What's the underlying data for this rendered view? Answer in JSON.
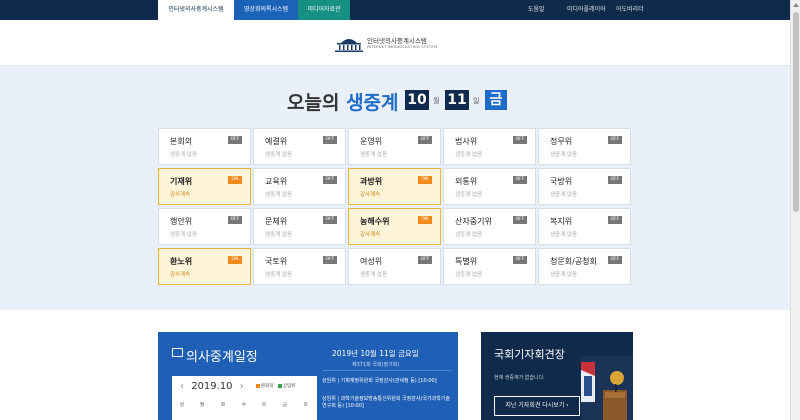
{
  "topbar": {
    "tabs": [
      {
        "label": "인터넷의사중계시스템"
      },
      {
        "label": "영상회의록시스템"
      },
      {
        "label": "미디어자료관"
      }
    ],
    "links": [
      {
        "label": "도움말"
      },
      {
        "label": "미디어플레이어"
      },
      {
        "label": "어도비리더"
      }
    ]
  },
  "logo": {
    "name_kr": "인터넷의사중계시스템",
    "name_en": "INTERNET BROADCASTING SYSTEM"
  },
  "today": {
    "prefix": "오늘의",
    "highlight": "생중계",
    "month": "10",
    "month_unit": "월",
    "day": "11",
    "day_unit": "일",
    "weekday": "금"
  },
  "committees": [
    {
      "name": "본회의",
      "status": "생중계 없음",
      "badge": "OFF",
      "live": false
    },
    {
      "name": "예결위",
      "status": "생중계 없음",
      "badge": "OFF",
      "live": false
    },
    {
      "name": "운영위",
      "status": "생중계 없음",
      "badge": "OFF",
      "live": false
    },
    {
      "name": "법사위",
      "status": "생중계 없음",
      "badge": "OFF",
      "live": false
    },
    {
      "name": "정무위",
      "status": "생중계 없음",
      "badge": "OFF",
      "live": false
    },
    {
      "name": "기재위",
      "status": "감사계속",
      "badge": "ON",
      "live": true
    },
    {
      "name": "교육위",
      "status": "생중계 없음",
      "badge": "OFF",
      "live": false
    },
    {
      "name": "과방위",
      "status": "감사계속",
      "badge": "ON",
      "live": true
    },
    {
      "name": "외통위",
      "status": "생중계 없음",
      "badge": "OFF",
      "live": false
    },
    {
      "name": "국방위",
      "status": "생중계 없음",
      "badge": "OFF",
      "live": false
    },
    {
      "name": "행안위",
      "status": "생중계 없음",
      "badge": "OFF",
      "live": false
    },
    {
      "name": "문체위",
      "status": "생중계 없음",
      "badge": "OFF",
      "live": false
    },
    {
      "name": "농해수위",
      "status": "감사계속",
      "badge": "ON",
      "live": true
    },
    {
      "name": "산자중기위",
      "status": "생중계 없음",
      "badge": "OFF",
      "live": false
    },
    {
      "name": "복지위",
      "status": "생중계 없음",
      "badge": "OFF",
      "live": false
    },
    {
      "name": "환노위",
      "status": "감사계속",
      "badge": "ON",
      "live": true
    },
    {
      "name": "국토위",
      "status": "생중계 없음",
      "badge": "OFF",
      "live": false
    },
    {
      "name": "여성위",
      "status": "생중계 없음",
      "badge": "OFF",
      "live": false
    },
    {
      "name": "특별위",
      "status": "생중계 없음",
      "badge": "OFF",
      "live": false
    },
    {
      "name": "청문회/공청회",
      "status": "생중계 없음",
      "badge": "OFF",
      "live": false
    }
  ],
  "schedule": {
    "title": "의사중계일정",
    "month_label": "2019.10",
    "prev": "‹",
    "next": "›",
    "legend": [
      {
        "label": "본회의",
        "color": "#f08a1c"
      },
      {
        "label": "상임위",
        "color": "#3aa35a"
      }
    ],
    "weekdays": [
      "일",
      "월",
      "화",
      "수",
      "목",
      "금",
      "토"
    ],
    "date_heading": "2019년 10월 11일 금요일",
    "session": "제371회 국회(정기회)",
    "items": [
      "상임위 | 기획재정위원회 국정감사(관세청 등) [10:00]",
      "상임위 | 과학기술정보방송통신위원회 국정감사(국가과학기술연구회 등) [10:00]"
    ]
  },
  "press": {
    "title": "국회기자회견장",
    "message": "현재 생중계가 없습니다.",
    "button": "지난 기자회견 다시보기 ›"
  },
  "colors": {
    "navy": "#0f2a4a",
    "blue": "#1e6cc8",
    "on_orange": "#f08a1c",
    "on_bg": "#fdf4da"
  }
}
